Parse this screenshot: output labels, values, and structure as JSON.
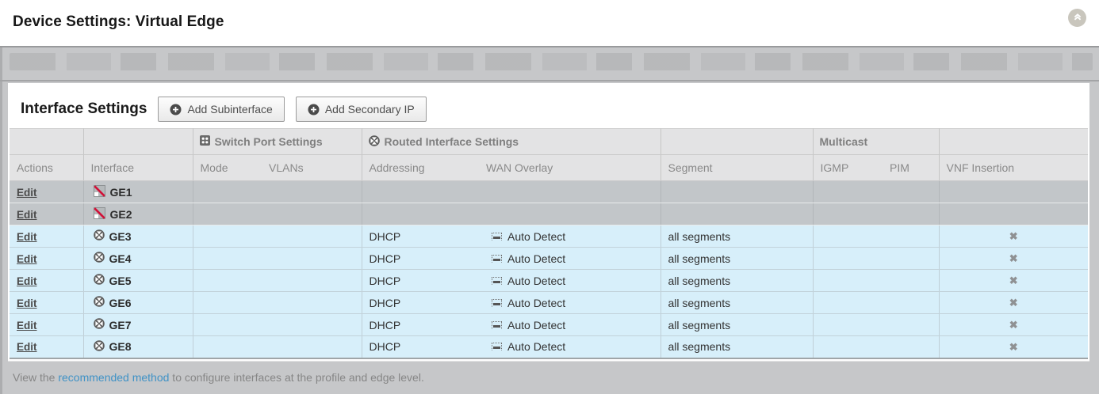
{
  "page": {
    "title": "Device Settings: Virtual Edge"
  },
  "panel": {
    "heading": "Interface Settings",
    "buttons": {
      "add_subinterface": "Add Subinterface",
      "add_secondary_ip": "Add Secondary IP"
    }
  },
  "table": {
    "groups": {
      "switch_port": "Switch Port Settings",
      "routed": "Routed Interface Settings",
      "multicast": "Multicast"
    },
    "columns": {
      "actions": "Actions",
      "interface": "Interface",
      "mode": "Mode",
      "vlans": "VLANs",
      "addressing": "Addressing",
      "wan_overlay": "WAN Overlay",
      "segment": "Segment",
      "igmp": "IGMP",
      "pim": "PIM",
      "vnf": "VNF Insertion"
    },
    "edit_label": "Edit",
    "vnf_none_glyph": "✖",
    "rows": [
      {
        "name": "GE1",
        "icon": "disabled-interface-icon",
        "state": "disabled",
        "addressing": "",
        "wan_overlay": "",
        "segment": ""
      },
      {
        "name": "GE2",
        "icon": "disabled-interface-icon",
        "state": "disabled",
        "addressing": "",
        "wan_overlay": "",
        "segment": ""
      },
      {
        "name": "GE3",
        "icon": "routed-interface-icon",
        "state": "routed",
        "addressing": "DHCP",
        "wan_overlay": "Auto Detect",
        "segment": "all segments"
      },
      {
        "name": "GE4",
        "icon": "routed-interface-icon",
        "state": "routed",
        "addressing": "DHCP",
        "wan_overlay": "Auto Detect",
        "segment": "all segments"
      },
      {
        "name": "GE5",
        "icon": "routed-interface-icon",
        "state": "routed",
        "addressing": "DHCP",
        "wan_overlay": "Auto Detect",
        "segment": "all segments"
      },
      {
        "name": "GE6",
        "icon": "routed-interface-icon",
        "state": "routed",
        "addressing": "DHCP",
        "wan_overlay": "Auto Detect",
        "segment": "all segments"
      },
      {
        "name": "GE7",
        "icon": "routed-interface-icon",
        "state": "routed",
        "addressing": "DHCP",
        "wan_overlay": "Auto Detect",
        "segment": "all segments"
      },
      {
        "name": "GE8",
        "icon": "routed-interface-icon",
        "state": "routed",
        "addressing": "DHCP",
        "wan_overlay": "Auto Detect",
        "segment": "all segments"
      }
    ]
  },
  "footer": {
    "prefix": "View the ",
    "link": "recommended method",
    "suffix": " to configure interfaces at the profile and edge level."
  },
  "colors": {
    "row_disabled_bg": "#c2c6c9",
    "row_active_bg": "#d7effa",
    "header_bg": "#e3e3e4",
    "link_blue": "#3f92c6",
    "disabled_red": "#d11138",
    "shell_gray": "#c6c7c9"
  }
}
